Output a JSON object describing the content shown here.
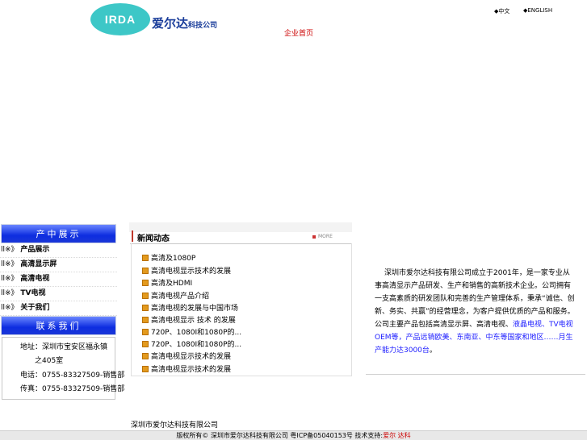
{
  "header": {
    "logo_text": "IRDA",
    "company_name_big": "爱尔达",
    "company_name_small": "科技公司",
    "lang_cn": "◆中文",
    "lang_en": "◆ENGLISH",
    "red_link": "企业首页"
  },
  "sidebar": {
    "products_title": "产中展示",
    "items": [
      {
        "prefix": "ll※》",
        "label": "产品展示"
      },
      {
        "prefix": "ll※》",
        "label": "高清显示屏"
      },
      {
        "prefix": "ll※》",
        "label": "高清电视"
      },
      {
        "prefix": "ll※》",
        "label": "TV电视"
      },
      {
        "prefix": "ll※》",
        "label": "关于我们"
      }
    ],
    "contact_title": "联系我们",
    "contact": {
      "line1": "地址：深圳市宝安区福永镇",
      "line2": "之405室",
      "line3": "电话：0755-83327509-销售部",
      "line4": "传真：0755-83327509-销售部"
    }
  },
  "news": {
    "title": "新闻动态",
    "more": "MORE",
    "items": [
      "高清及1080P",
      "高清电视显示技术的发展",
      "高清及HDMI",
      "高清电视产品介绍",
      "高清电视的发展与中国市场",
      "高清电视显示 技术 的发展",
      "720P、1080I和1080P的...",
      "720P、1080I和1080P的...",
      "高清电视显示技术的发展",
      "高清电视显示技术的发展"
    ]
  },
  "about": {
    "text_a": "深圳市爱尔达科技有限公司成立于2001年，是一家专业从事高清显示产品研发、生产和销售的高新技术企业。公司拥有一支高素质的研发团队和完善的生产管理体系，秉承“诚信、创新、务实、共赢”的经营理念，为客户提供优质的产品和服务。公司主要产品包括高清显示屏、高清电视、",
    "text_blue": "液晶电视、TV电视OEM等，产品远销欧美、东南亚、中东等国家和地区……月生产能力达3000台",
    "text_end": "。"
  },
  "footer": {
    "note": "深圳市爱尔达科技有限公司",
    "copyright": "版权所有© 深圳市爱尔达科技有限公司  粤ICP备05040153号  技术支持:",
    "support_link": "爱尔 达科"
  }
}
